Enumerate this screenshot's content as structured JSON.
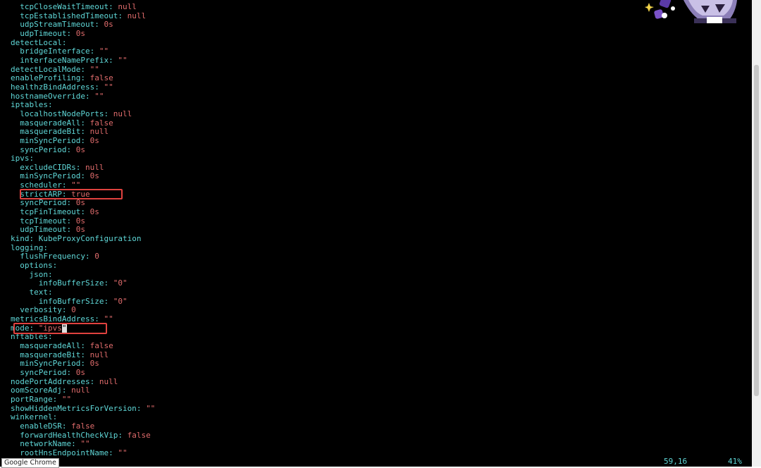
{
  "editor": {
    "lines": [
      {
        "indent": "  ",
        "key": "tcpCloseWaitTimeout",
        "value": "null"
      },
      {
        "indent": "  ",
        "key": "tcpEstablishedTimeout",
        "value": "null"
      },
      {
        "indent": "  ",
        "key": "udpStreamTimeout",
        "value": "0s"
      },
      {
        "indent": "  ",
        "key": "udpTimeout",
        "value": "0s"
      },
      {
        "indent": "",
        "key": "detectLocal",
        "value": ""
      },
      {
        "indent": "  ",
        "key": "bridgeInterface",
        "value": "\"\""
      },
      {
        "indent": "  ",
        "key": "interfaceNamePrefix",
        "value": "\"\""
      },
      {
        "indent": "",
        "key": "detectLocalMode",
        "value": "\"\""
      },
      {
        "indent": "",
        "key": "enableProfiling",
        "value": "false"
      },
      {
        "indent": "",
        "key": "healthzBindAddress",
        "value": "\"\""
      },
      {
        "indent": "",
        "key": "hostnameOverride",
        "value": "\"\""
      },
      {
        "indent": "",
        "key": "iptables",
        "value": ""
      },
      {
        "indent": "  ",
        "key": "localhostNodePorts",
        "value": "null"
      },
      {
        "indent": "  ",
        "key": "masqueradeAll",
        "value": "false"
      },
      {
        "indent": "  ",
        "key": "masqueradeBit",
        "value": "null"
      },
      {
        "indent": "  ",
        "key": "minSyncPeriod",
        "value": "0s"
      },
      {
        "indent": "  ",
        "key": "syncPeriod",
        "value": "0s"
      },
      {
        "indent": "",
        "key": "ipvs",
        "value": ""
      },
      {
        "indent": "  ",
        "key": "excludeCIDRs",
        "value": "null"
      },
      {
        "indent": "  ",
        "key": "minSyncPeriod",
        "value": "0s"
      },
      {
        "indent": "  ",
        "key": "scheduler",
        "value": "\"\""
      },
      {
        "indent": "  ",
        "key": "strictARP",
        "value": "true"
      },
      {
        "indent": "  ",
        "key": "syncPeriod",
        "value": "0s"
      },
      {
        "indent": "  ",
        "key": "tcpFinTimeout",
        "value": "0s"
      },
      {
        "indent": "  ",
        "key": "tcpTimeout",
        "value": "0s"
      },
      {
        "indent": "  ",
        "key": "udpTimeout",
        "value": "0s"
      },
      {
        "indent": "",
        "key": "kind",
        "value": "KubeProxyConfiguration",
        "value_color": "key"
      },
      {
        "indent": "",
        "key": "logging",
        "value": ""
      },
      {
        "indent": "  ",
        "key": "flushFrequency",
        "value": "0"
      },
      {
        "indent": "  ",
        "key": "options",
        "value": ""
      },
      {
        "indent": "    ",
        "key": "json",
        "value": ""
      },
      {
        "indent": "      ",
        "key": "infoBufferSize",
        "value": "\"0\""
      },
      {
        "indent": "    ",
        "key": "text",
        "value": ""
      },
      {
        "indent": "      ",
        "key": "infoBufferSize",
        "value": "\"0\""
      },
      {
        "indent": "  ",
        "key": "verbosity",
        "value": "0"
      },
      {
        "indent": "",
        "key": "metricsBindAddress",
        "value": "\"\""
      },
      {
        "indent": "",
        "key": "mode",
        "value": "\"ipvs",
        "cursor": "\""
      },
      {
        "indent": "",
        "key": "nftables",
        "value": ""
      },
      {
        "indent": "  ",
        "key": "masqueradeAll",
        "value": "false"
      },
      {
        "indent": "  ",
        "key": "masqueradeBit",
        "value": "null"
      },
      {
        "indent": "  ",
        "key": "minSyncPeriod",
        "value": "0s"
      },
      {
        "indent": "  ",
        "key": "syncPeriod",
        "value": "0s"
      },
      {
        "indent": "",
        "key": "nodePortAddresses",
        "value": "null"
      },
      {
        "indent": "",
        "key": "oomScoreAdj",
        "value": "null"
      },
      {
        "indent": "",
        "key": "portRange",
        "value": "\"\""
      },
      {
        "indent": "",
        "key": "showHiddenMetricsForVersion",
        "value": "\"\""
      },
      {
        "indent": "",
        "key": "winkernel",
        "value": ""
      },
      {
        "indent": "  ",
        "key": "enableDSR",
        "value": "false"
      },
      {
        "indent": "  ",
        "key": "forwardHealthCheckVip",
        "value": "false"
      },
      {
        "indent": "  ",
        "key": "networkName",
        "value": "\"\""
      },
      {
        "indent": "  ",
        "key": "rootHnsEndpointName",
        "value": "\"\""
      }
    ],
    "highlighted_keys": [
      "strictARP",
      "mode"
    ]
  },
  "status": {
    "cursor_position": "59,16",
    "scroll_percent": "41%"
  },
  "tooltip": {
    "text": "Google Chrome"
  },
  "colors": {
    "key": "#5fd7d7",
    "value": "#e06c6c",
    "highlight_box": "#e0423f",
    "background": "#000000"
  }
}
